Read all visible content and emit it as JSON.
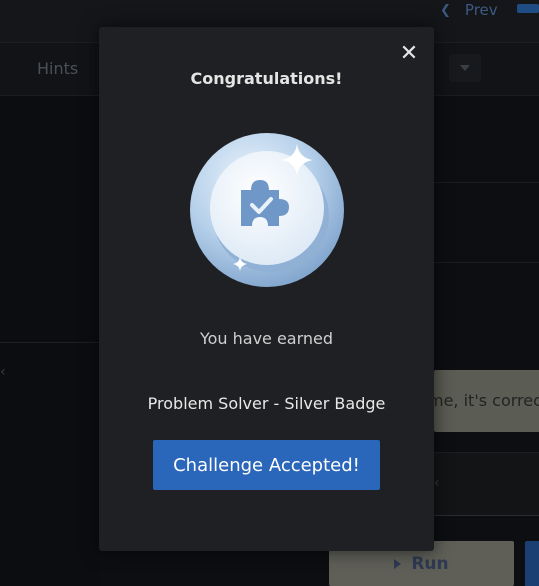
{
  "background": {
    "prev_label": "Prev",
    "hints_tab": "Hints",
    "feedback_text": "me, it's correc",
    "run_label": "Run"
  },
  "modal": {
    "title": "Congratulations!",
    "close_icon": "close-icon",
    "badge_icon": "silver-puzzle-badge",
    "earned_text": "You have earned",
    "badge_name": "Problem Solver - Silver Badge",
    "accept_label": "Challenge Accepted!"
  },
  "colors": {
    "modal_bg": "#1f2024",
    "accent_button": "#2a66b9",
    "badge_silver": "#b9d3ec"
  }
}
